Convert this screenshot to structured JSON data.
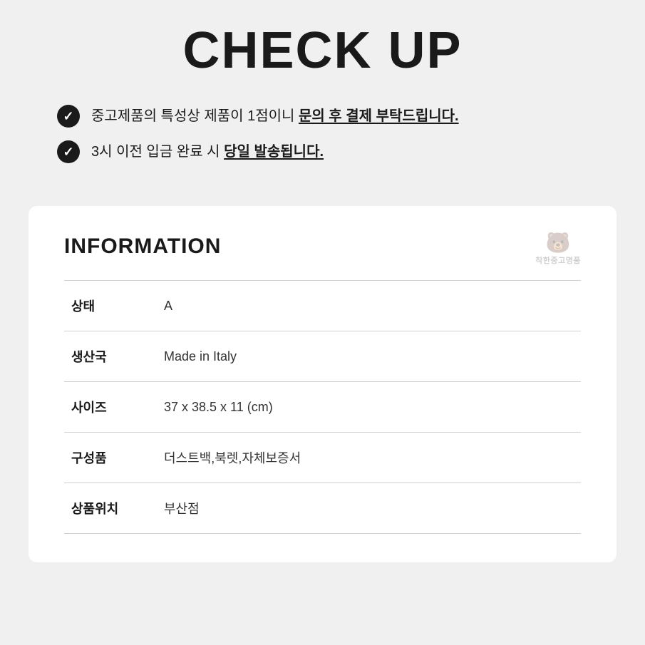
{
  "header": {
    "title": "CHECK UP"
  },
  "checklist": {
    "items": [
      {
        "id": "item-1",
        "text_normal": "중고제품의 특성상 제품이 1점이니 ",
        "text_bold": "문의 후 결제 부탁드립니다."
      },
      {
        "id": "item-2",
        "text_normal": "3시 이전 입금 완료 시 ",
        "text_bold": "당일 발송됩니다."
      }
    ]
  },
  "information": {
    "section_title": "INFORMATION",
    "watermark_label": "착한중고명품",
    "rows": [
      {
        "label": "상태",
        "value": "A"
      },
      {
        "label": "생산국",
        "value": "Made in Italy"
      },
      {
        "label": "사이즈",
        "value": "37 x 38.5 x 11 (cm)"
      },
      {
        "label": "구성품",
        "value": "더스트백,북렛,자체보증서"
      },
      {
        "label": "상품위치",
        "value": "부산점"
      }
    ]
  }
}
